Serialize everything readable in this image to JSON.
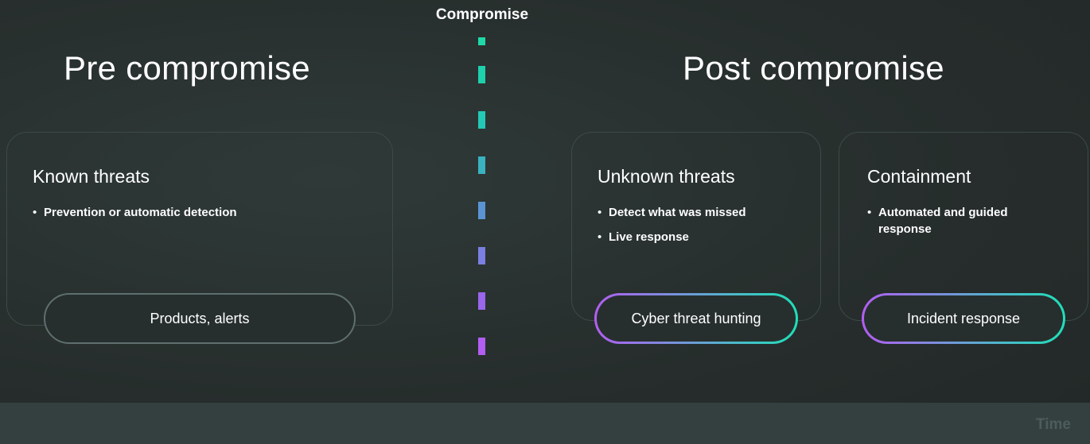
{
  "marker": {
    "label": "Compromise",
    "dash_colors": [
      "#1fd9a8",
      "#1fd0ad",
      "#24c9b4",
      "#3ab2c0",
      "#5a94d3",
      "#7a7fe1",
      "#9a66eb",
      "#b25ef2"
    ]
  },
  "pre": {
    "heading": "Pre compromise",
    "card": {
      "title": "Known threats",
      "bullets": [
        "Prevention or automatic detection"
      ],
      "pill": "Products, alerts"
    }
  },
  "post": {
    "heading": "Post compromise",
    "cards": [
      {
        "title": "Unknown threats",
        "bullets": [
          "Detect what was missed",
          "Live response"
        ],
        "pill": "Cyber threat hunting"
      },
      {
        "title": "Containment",
        "bullets": [
          "Automated and guided response"
        ],
        "pill": "Incident response"
      }
    ]
  },
  "timeline": {
    "label": "Time"
  },
  "colors": {
    "gradient_start": "#b25ef2",
    "gradient_end": "#1fe0b8",
    "plain_border": "#5e6f6d"
  }
}
